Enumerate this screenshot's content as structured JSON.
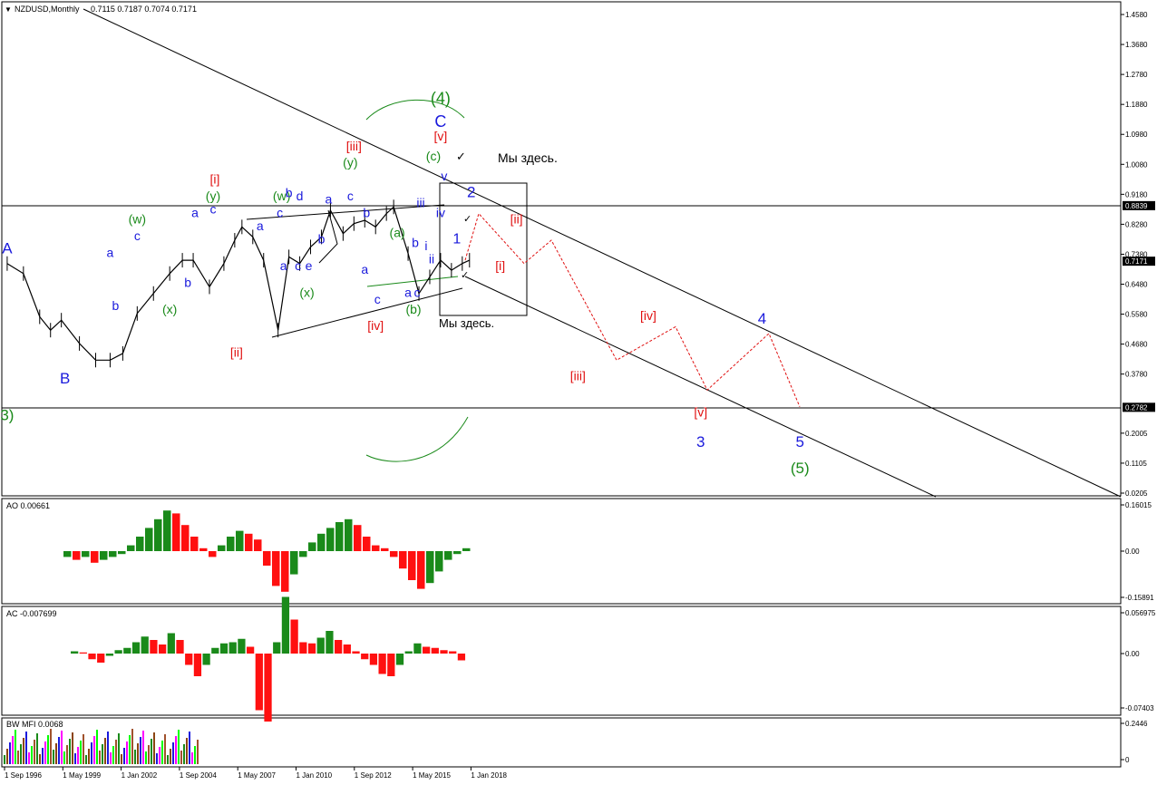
{
  "window": {
    "symbol": "NZDUSD,Monthly",
    "ohlc": "0.7115 0.7187 0.7074 0.7171"
  },
  "colors": {
    "blue": "#1a1adc",
    "green": "#1a8a1a",
    "red": "#e01010",
    "black": "#000000",
    "ao_up": "#1a8a1a",
    "ao_down": "#ff1010"
  },
  "price_axis": {
    "ticks": [
      "1.4580",
      "1.3680",
      "1.2780",
      "1.1880",
      "1.0980",
      "1.0080",
      "0.9180",
      "0.8839",
      "0.8280",
      "0.7380",
      "0.7171",
      "0.6480",
      "0.5580",
      "0.4680",
      "0.3780",
      "0.2782",
      "0.2005",
      "0.1105",
      "0.0205"
    ],
    "highlight": [
      "0.8839",
      "0.7171",
      "0.2782"
    ]
  },
  "ao_pane": {
    "title": "AO 0.00661",
    "ticks": [
      "0.16015",
      "0.00",
      "-0.15891"
    ]
  },
  "ac_pane": {
    "title": "AC -0.007699",
    "ticks": [
      "0.056975",
      "0.00",
      "-0.07403"
    ]
  },
  "bw_pane": {
    "title": "BW MFI 0.0068",
    "ticks": [
      "0.2446",
      "0"
    ]
  },
  "time_axis": [
    "1 Sep 1996",
    "1 May 1999",
    "1 Jan 2002",
    "1 Sep 2004",
    "1 May 2007",
    "1 Jan 2010",
    "1 Sep 2012",
    "1 May 2015",
    "1 Jan 2018"
  ],
  "annotations": {
    "here_top": "Мы здесь.",
    "here_box": "Мы здесь."
  },
  "chart_data": {
    "type": "line",
    "title": "NZDUSD,Monthly",
    "xlabel": "",
    "ylabel": "",
    "ylim": [
      0.0205,
      1.458
    ],
    "series": [
      {
        "name": "NZDUSD",
        "x": [
          "1996-09",
          "1997-06",
          "1998-03",
          "1998-09",
          "1999-03",
          "2000-01",
          "2000-10",
          "2001-06",
          "2002-01",
          "2002-09",
          "2003-06",
          "2004-03",
          "2004-10",
          "2005-04",
          "2006-01",
          "2006-09",
          "2007-03",
          "2007-07",
          "2008-01",
          "2008-07",
          "2009-03",
          "2009-09",
          "2010-03",
          "2010-09",
          "2011-03",
          "2011-08",
          "2012-03",
          "2012-09",
          "2013-03",
          "2013-09",
          "2014-03",
          "2014-07",
          "2015-03",
          "2015-09",
          "2016-03",
          "2016-09",
          "2017-03",
          "2017-09",
          "2018-01"
        ],
        "values": [
          0.71,
          0.68,
          0.55,
          0.51,
          0.54,
          0.47,
          0.42,
          0.42,
          0.44,
          0.56,
          0.62,
          0.68,
          0.72,
          0.72,
          0.64,
          0.71,
          0.78,
          0.82,
          0.79,
          0.72,
          0.51,
          0.73,
          0.71,
          0.76,
          0.79,
          0.87,
          0.8,
          0.83,
          0.84,
          0.82,
          0.86,
          0.88,
          0.74,
          0.62,
          0.67,
          0.72,
          0.69,
          0.71,
          0.72
        ]
      }
    ],
    "forecast": {
      "values_red": [
        0.72,
        0.86,
        0.71,
        0.78,
        0.42,
        0.52,
        0.33,
        0.5,
        0.28
      ]
    },
    "wave_labels": [
      {
        "text": "A",
        "x": "1996-09",
        "y": 0.74,
        "color": "blue",
        "size": 17
      },
      {
        "text": "B",
        "x": "1999-05",
        "y": 0.35,
        "color": "blue",
        "size": 17
      },
      {
        "text": "3)",
        "x": "1996-09",
        "y": 0.24,
        "color": "green",
        "size": 17
      },
      {
        "text": "a",
        "x": "2001-06",
        "y": 0.73,
        "color": "blue",
        "size": 14
      },
      {
        "text": "b",
        "x": "2001-09",
        "y": 0.57,
        "color": "blue",
        "size": 14
      },
      {
        "text": "c",
        "x": "2002-09",
        "y": 0.78,
        "color": "blue",
        "size": 14
      },
      {
        "text": "(w)",
        "x": "2002-09",
        "y": 0.83,
        "color": "green",
        "size": 14
      },
      {
        "text": "(x)",
        "x": "2004-03",
        "y": 0.56,
        "color": "green",
        "size": 14
      },
      {
        "text": "b",
        "x": "2005-01",
        "y": 0.64,
        "color": "blue",
        "size": 14
      },
      {
        "text": "a",
        "x": "2005-05",
        "y": 0.85,
        "color": "blue",
        "size": 14
      },
      {
        "text": "c",
        "x": "2006-03",
        "y": 0.86,
        "color": "blue",
        "size": 14
      },
      {
        "text": "(y)",
        "x": "2006-03",
        "y": 0.9,
        "color": "green",
        "size": 14
      },
      {
        "text": "[i]",
        "x": "2006-04",
        "y": 0.95,
        "color": "red",
        "size": 14
      },
      {
        "text": "[ii]",
        "x": "2007-04",
        "y": 0.43,
        "color": "red",
        "size": 14
      },
      {
        "text": "a",
        "x": "2008-05",
        "y": 0.81,
        "color": "blue",
        "size": 14
      },
      {
        "text": "c",
        "x": "2009-04",
        "y": 0.85,
        "color": "blue",
        "size": 14
      },
      {
        "text": "(w)",
        "x": "2009-05",
        "y": 0.9,
        "color": "green",
        "size": 14
      },
      {
        "text": "b",
        "x": "2009-09",
        "y": 0.91,
        "color": "blue",
        "size": 14
      },
      {
        "text": "d",
        "x": "2010-03",
        "y": 0.9,
        "color": "blue",
        "size": 14
      },
      {
        "text": "a",
        "x": "2009-06",
        "y": 0.69,
        "color": "blue",
        "size": 14
      },
      {
        "text": "c",
        "x": "2010-02",
        "y": 0.69,
        "color": "blue",
        "size": 14
      },
      {
        "text": "e",
        "x": "2010-08",
        "y": 0.69,
        "color": "blue",
        "size": 14
      },
      {
        "text": "(x)",
        "x": "2010-07",
        "y": 0.61,
        "color": "green",
        "size": 14
      },
      {
        "text": "b",
        "x": "2011-03",
        "y": 0.77,
        "color": "blue",
        "size": 14
      },
      {
        "text": "a",
        "x": "2011-07",
        "y": 0.89,
        "color": "blue",
        "size": 14
      },
      {
        "text": "c",
        "x": "2012-07",
        "y": 0.9,
        "color": "blue",
        "size": 14
      },
      {
        "text": "b",
        "x": "2013-04",
        "y": 0.85,
        "color": "blue",
        "size": 14
      },
      {
        "text": "(y)",
        "x": "2012-07",
        "y": 1.0,
        "color": "green",
        "size": 14
      },
      {
        "text": "[iii]",
        "x": "2012-09",
        "y": 1.05,
        "color": "red",
        "size": 14
      },
      {
        "text": "a",
        "x": "2013-03",
        "y": 0.68,
        "color": "blue",
        "size": 14
      },
      {
        "text": "c",
        "x": "2013-10",
        "y": 0.59,
        "color": "blue",
        "size": 14
      },
      {
        "text": "[iv]",
        "x": "2013-09",
        "y": 0.51,
        "color": "red",
        "size": 14
      },
      {
        "text": "(a)",
        "x": "2014-09",
        "y": 0.79,
        "color": "green",
        "size": 14
      },
      {
        "text": "b",
        "x": "2015-07",
        "y": 0.76,
        "color": "blue",
        "size": 14
      },
      {
        "text": "a",
        "x": "2015-03",
        "y": 0.61,
        "color": "blue",
        "size": 14
      },
      {
        "text": "c",
        "x": "2015-08",
        "y": 0.61,
        "color": "blue",
        "size": 14
      },
      {
        "text": "(b)",
        "x": "2015-06",
        "y": 0.56,
        "color": "green",
        "size": 14
      },
      {
        "text": "i",
        "x": "2016-01",
        "y": 0.75,
        "color": "blue",
        "size": 14
      },
      {
        "text": "ii",
        "x": "2016-04",
        "y": 0.71,
        "color": "blue",
        "size": 14
      },
      {
        "text": "iii",
        "x": "2015-10",
        "y": 0.88,
        "color": "blue",
        "size": 14
      },
      {
        "text": "iv",
        "x": "2016-09",
        "y": 0.85,
        "color": "blue",
        "size": 14
      },
      {
        "text": "1",
        "x": "2017-06",
        "y": 0.77,
        "color": "blue",
        "size": 16
      },
      {
        "text": "v",
        "x": "2016-11",
        "y": 0.96,
        "color": "blue",
        "size": 14
      },
      {
        "text": "2",
        "x": "2018-02",
        "y": 0.91,
        "color": "blue",
        "size": 17
      },
      {
        "text": "(c)",
        "x": "2016-05",
        "y": 1.02,
        "color": "green",
        "size": 14
      },
      {
        "text": "[v]",
        "x": "2016-09",
        "y": 1.08,
        "color": "red",
        "size": 14
      },
      {
        "text": "C",
        "x": "2016-09",
        "y": 1.12,
        "color": "blue",
        "size": 18
      },
      {
        "text": "(4)",
        "x": "2016-09",
        "y": 1.19,
        "color": "green",
        "size": 18
      },
      {
        "text": "[i]",
        "x": "2019-06",
        "y": 0.69,
        "color": "red",
        "size": 14
      },
      {
        "text": "[ii]",
        "x": "2020-03",
        "y": 0.83,
        "color": "red",
        "size": 14
      },
      {
        "text": "[iii]",
        "x": "2023-01",
        "y": 0.36,
        "color": "red",
        "size": 14
      },
      {
        "text": "[iv]",
        "x": "2026-04",
        "y": 0.54,
        "color": "red",
        "size": 14
      },
      {
        "text": "[v]",
        "x": "2028-09",
        "y": 0.25,
        "color": "red",
        "size": 14
      },
      {
        "text": "3",
        "x": "2028-09",
        "y": 0.16,
        "color": "blue",
        "size": 17
      },
      {
        "text": "4",
        "x": "2031-07",
        "y": 0.53,
        "color": "blue",
        "size": 17
      },
      {
        "text": "5",
        "x": "2033-04",
        "y": 0.16,
        "color": "blue",
        "size": 17
      },
      {
        "text": "(5)",
        "x": "2033-04",
        "y": 0.08,
        "color": "green",
        "size": 17
      }
    ],
    "ao": {
      "values": [
        -0.02,
        -0.03,
        -0.02,
        -0.04,
        -0.03,
        -0.02,
        -0.01,
        0.02,
        0.05,
        0.08,
        0.11,
        0.14,
        0.13,
        0.09,
        0.05,
        0.01,
        -0.02,
        0.02,
        0.05,
        0.07,
        0.06,
        0.04,
        -0.05,
        -0.12,
        -0.14,
        -0.08,
        -0.02,
        0.03,
        0.06,
        0.08,
        0.1,
        0.11,
        0.09,
        0.05,
        0.02,
        0.01,
        -0.02,
        -0.06,
        -0.1,
        -0.13,
        -0.11,
        -0.07,
        -0.03,
        -0.01,
        0.01
      ]
    },
    "ac": {
      "values": [
        0.002,
        0.001,
        -0.005,
        -0.008,
        -0.002,
        0.003,
        0.005,
        0.01,
        0.015,
        0.012,
        0.008,
        0.018,
        0.012,
        -0.01,
        -0.02,
        -0.01,
        0.005,
        0.009,
        0.01,
        0.013,
        0.006,
        -0.05,
        -0.06,
        0.01,
        0.05,
        0.03,
        0.01,
        0.009,
        0.014,
        0.02,
        0.012,
        0.008,
        0.002,
        -0.005,
        -0.01,
        -0.018,
        -0.02,
        -0.01,
        0.002,
        0.009,
        0.006,
        0.005,
        0.003,
        0.002,
        -0.006
      ]
    }
  }
}
